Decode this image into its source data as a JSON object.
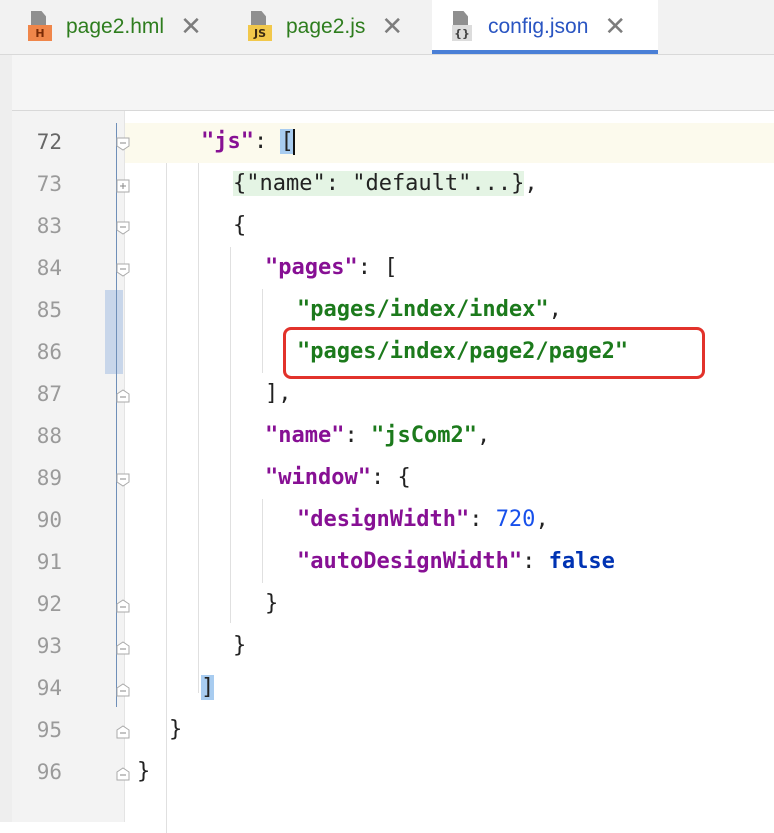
{
  "tabs": [
    {
      "label": "page2.hml",
      "icon": "hml-file-icon",
      "badge": "H",
      "active": false
    },
    {
      "label": "page2.js",
      "icon": "js-file-icon",
      "badge": "JS",
      "active": false
    },
    {
      "label": "config.json",
      "icon": "json-file-icon",
      "badge": "{}",
      "active": true
    }
  ],
  "close_glyph": "✕",
  "editor": {
    "lines": [
      {
        "num": "72"
      },
      {
        "num": "73"
      },
      {
        "num": "83"
      },
      {
        "num": "84"
      },
      {
        "num": "85"
      },
      {
        "num": "86"
      },
      {
        "num": "87"
      },
      {
        "num": "88"
      },
      {
        "num": "89"
      },
      {
        "num": "90"
      },
      {
        "num": "91"
      },
      {
        "num": "92"
      },
      {
        "num": "93"
      },
      {
        "num": "94"
      },
      {
        "num": "95"
      },
      {
        "num": "96"
      }
    ],
    "code": {
      "l72_key": "\"js\"",
      "l72_colon": ": ",
      "l72_bracket": "[",
      "l73_fold": "{\"name\": \"default\"...}",
      "l73_comma": ",",
      "l83_brace": "{",
      "l84_key": "\"pages\"",
      "l84_rest": ": [",
      "l85_str": "\"pages/index/index\"",
      "l85_comma": ",",
      "l86_str": "\"pages/index/page2/page2\"",
      "l87": "],",
      "l88_key": "\"name\"",
      "l88_colon": ": ",
      "l88_val": "\"jsCom2\"",
      "l88_comma": ",",
      "l89_key": "\"window\"",
      "l89_rest": ": {",
      "l90_key": "\"designWidth\"",
      "l90_colon": ": ",
      "l90_val": "720",
      "l90_comma": ",",
      "l91_key": "\"autoDesignWidth\"",
      "l91_colon": ": ",
      "l91_val": "false",
      "l92": "}",
      "l93": "}",
      "l94": "]",
      "l95": "}",
      "l96": "}"
    }
  },
  "colors": {
    "key": "#871094",
    "string": "#1c7a1c",
    "number": "#1750eb",
    "keyword": "#0033b3",
    "highlight_box": "#e2322b",
    "active_tab_underline": "#4a7fd6"
  }
}
